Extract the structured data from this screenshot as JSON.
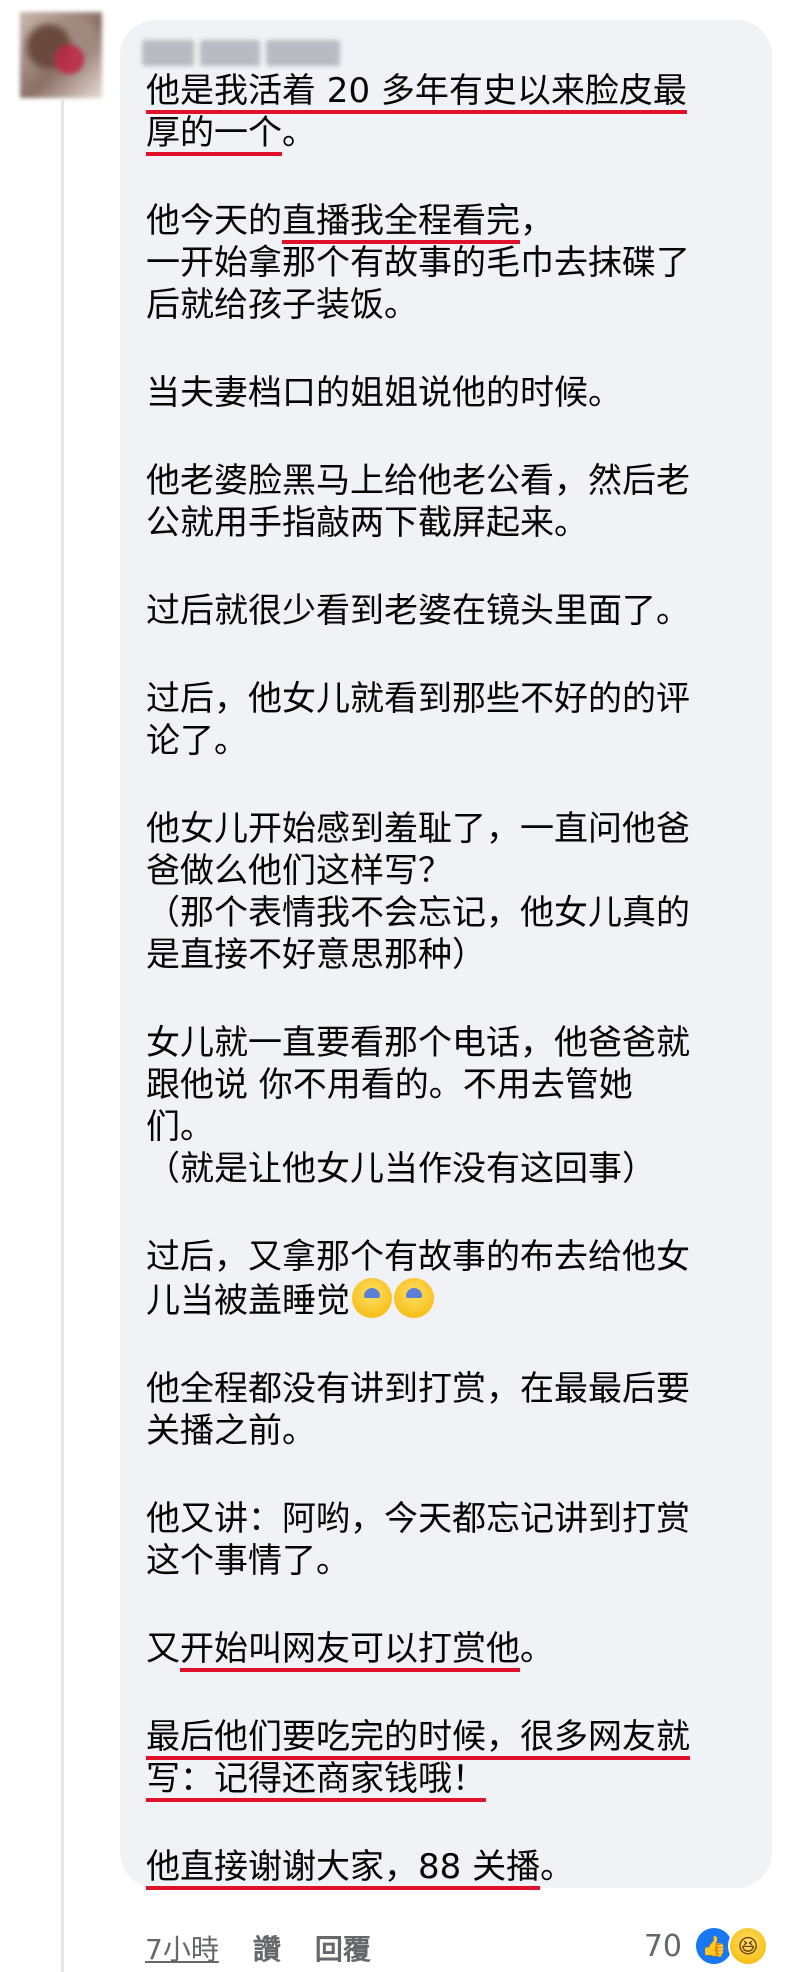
{
  "comment": {
    "paragraphs": [
      {
        "lines": [
          [
            {
              "t": "他是我活着 20 多年有史以来脸皮最",
              "u": true
            }
          ],
          [
            {
              "t": "厚的一个",
              "u": true
            },
            {
              "t": "。",
              "u": false
            }
          ]
        ]
      },
      {
        "lines": [
          [
            {
              "t": "他今天的",
              "u": false
            },
            {
              "t": "直播我全程看完",
              "u": true
            },
            {
              "t": "，",
              "u": false
            }
          ],
          [
            {
              "t": "一开始拿那个有故事的毛巾去抹碟了",
              "u": false
            }
          ],
          [
            {
              "t": "后就给孩子装饭。",
              "u": false
            }
          ]
        ]
      },
      {
        "lines": [
          [
            {
              "t": "当夫妻档口的姐姐说他的时候。",
              "u": false
            }
          ]
        ]
      },
      {
        "lines": [
          [
            {
              "t": "他老婆脸黑马上给他老公看，然后老",
              "u": false
            }
          ],
          [
            {
              "t": "公就用手指敲两下截屏起来。",
              "u": false
            }
          ]
        ]
      },
      {
        "lines": [
          [
            {
              "t": "过后就很少看到老婆在镜头里面了。",
              "u": false
            }
          ]
        ]
      },
      {
        "lines": [
          [
            {
              "t": "过后，他女儿就看到那些不好的的评",
              "u": false
            }
          ],
          [
            {
              "t": "论了。",
              "u": false
            }
          ]
        ]
      },
      {
        "lines": [
          [
            {
              "t": "他女儿开始感到羞耻了，一直问他爸",
              "u": false
            }
          ],
          [
            {
              "t": "爸做么他们这样写？",
              "u": false
            }
          ],
          [
            {
              "t": "（那个表情我不会忘记，他女儿真的",
              "u": false
            }
          ],
          [
            {
              "t": "是直接不好意思那种）",
              "u": false
            }
          ]
        ]
      },
      {
        "lines": [
          [
            {
              "t": "女儿就一直要看那个电话，他爸爸就",
              "u": false
            }
          ],
          [
            {
              "t": "跟他说 你不用看的。不用去管她",
              "u": false
            }
          ],
          [
            {
              "t": "们。",
              "u": false
            }
          ],
          [
            {
              "t": "（就是让他女儿当作没有这回事）",
              "u": false
            }
          ]
        ]
      },
      {
        "lines": [
          [
            {
              "t": "过后，又拿那个有故事的布去给他女",
              "u": false
            }
          ],
          [
            {
              "t": "儿当被盖睡觉",
              "u": false
            },
            {
              "emoji": "anxious-face"
            },
            {
              "emoji": "anxious-face"
            }
          ]
        ]
      },
      {
        "lines": [
          [
            {
              "t": "他全程都没有讲到打赏，在最最后要",
              "u": false
            }
          ],
          [
            {
              "t": "关播之前。",
              "u": false
            }
          ]
        ]
      },
      {
        "lines": [
          [
            {
              "t": "他又讲：阿哟，今天都忘记讲到打赏",
              "u": false
            }
          ],
          [
            {
              "t": "这个事情了。",
              "u": false
            }
          ]
        ]
      },
      {
        "lines": [
          [
            {
              "t": "又",
              "u": false
            },
            {
              "t": "开始叫网友可以打赏他",
              "u": true
            },
            {
              "t": "。",
              "u": false
            }
          ]
        ]
      },
      {
        "lines": [
          [
            {
              "t": "最后他们要吃完的时候，很多网友就",
              "u": true
            }
          ],
          [
            {
              "t": "写：记得还商家钱哦！",
              "u": true
            }
          ]
        ]
      },
      {
        "lines": [
          [
            {
              "t": "他直接谢谢大家，88 关播",
              "u": true
            },
            {
              "t": "。",
              "u": false
            }
          ]
        ]
      }
    ],
    "underline_color": "#e0112b"
  },
  "actions": {
    "time": "7小時",
    "like": "讚",
    "reply": "回覆"
  },
  "reactions": {
    "count": "70",
    "icons": [
      "like-icon",
      "haha-icon"
    ]
  }
}
